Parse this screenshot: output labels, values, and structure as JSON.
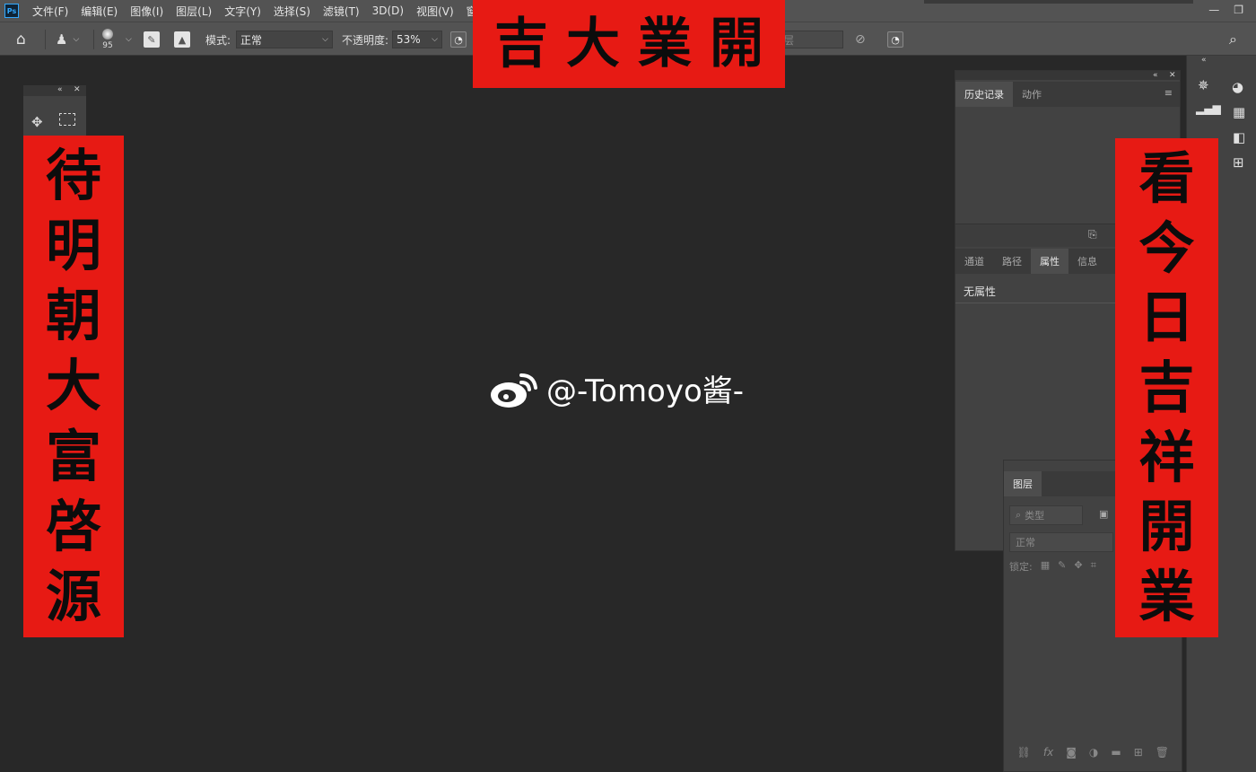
{
  "app": {
    "logo": "Ps"
  },
  "menu": [
    "文件(F)",
    "编辑(E)",
    "图像(I)",
    "图层(L)",
    "文字(Y)",
    "选择(S)",
    "滤镜(T)",
    "3D(D)",
    "视图(V)",
    "窗口"
  ],
  "options": {
    "brush_size": "95",
    "mode_label": "模式:",
    "mode_value": "正常",
    "opacity_label": "不透明度:",
    "opacity_value": "53%",
    "hidden_field_text": "层"
  },
  "couplets": {
    "horizontal": [
      "吉",
      "大",
      "業",
      "開"
    ],
    "left": [
      "待",
      "明",
      "朝",
      "大",
      "富",
      "啓",
      "源"
    ],
    "right": [
      "看",
      "今",
      "日",
      "吉",
      "祥",
      "開",
      "業"
    ]
  },
  "panels": {
    "history": {
      "tabs": [
        "历史记录",
        "动作"
      ],
      "active": 0
    },
    "properties": {
      "tabs": [
        "通道",
        "路径",
        "属性",
        "信息"
      ],
      "active": 2,
      "content": "无属性"
    },
    "layers": {
      "tab": "图层",
      "search_placeholder": "类型",
      "blend_mode": "正常",
      "lock_label": "锁定:"
    }
  },
  "watermark": {
    "text": "@-Tomoyo酱-"
  },
  "colors": {
    "couplet_red": "#e71a14",
    "canvas": "#282828",
    "ui_gray": "#535353",
    "panel": "#424242"
  },
  "icons": [
    "home-icon",
    "stamp-icon",
    "brush-preset-icon",
    "toggle-panel-icon",
    "person-icon",
    "airbrush-icon",
    "search-icon",
    "move-icon",
    "marquee-icon",
    "weibo-icon"
  ]
}
